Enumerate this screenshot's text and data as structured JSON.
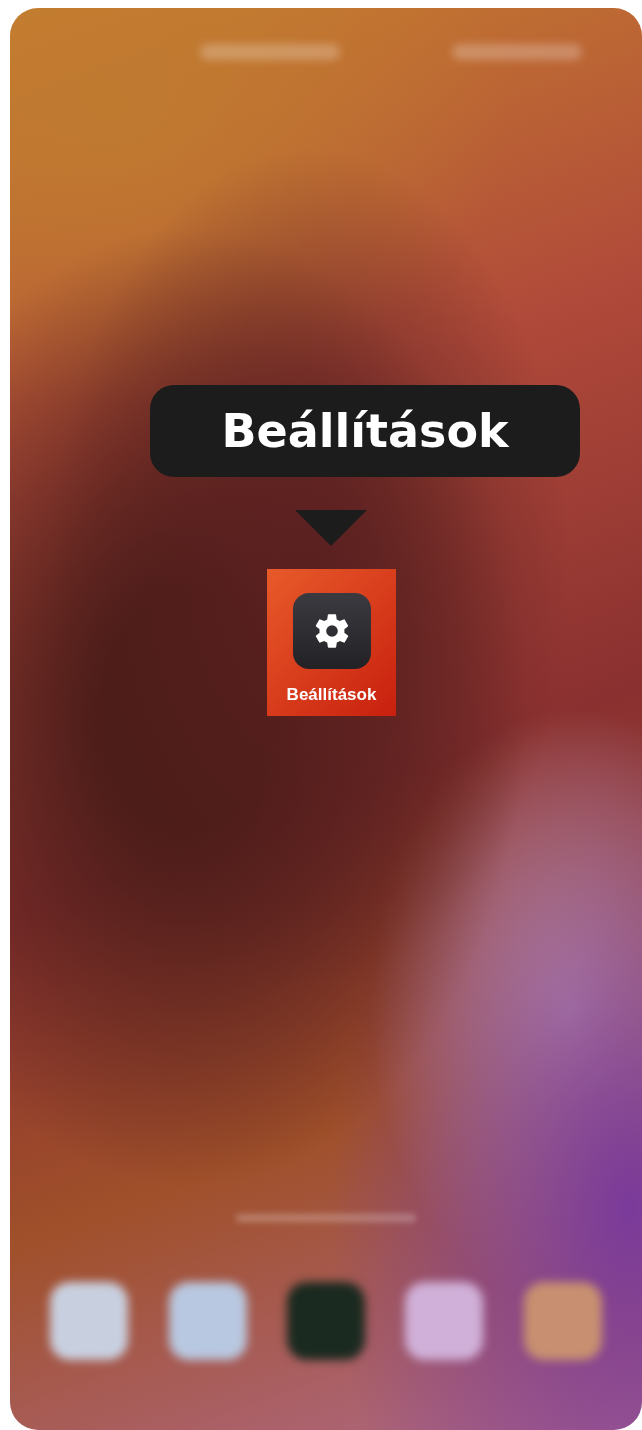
{
  "tooltip": {
    "label": "Beállítások"
  },
  "app": {
    "label": "Beállítások",
    "highlighted": true
  }
}
